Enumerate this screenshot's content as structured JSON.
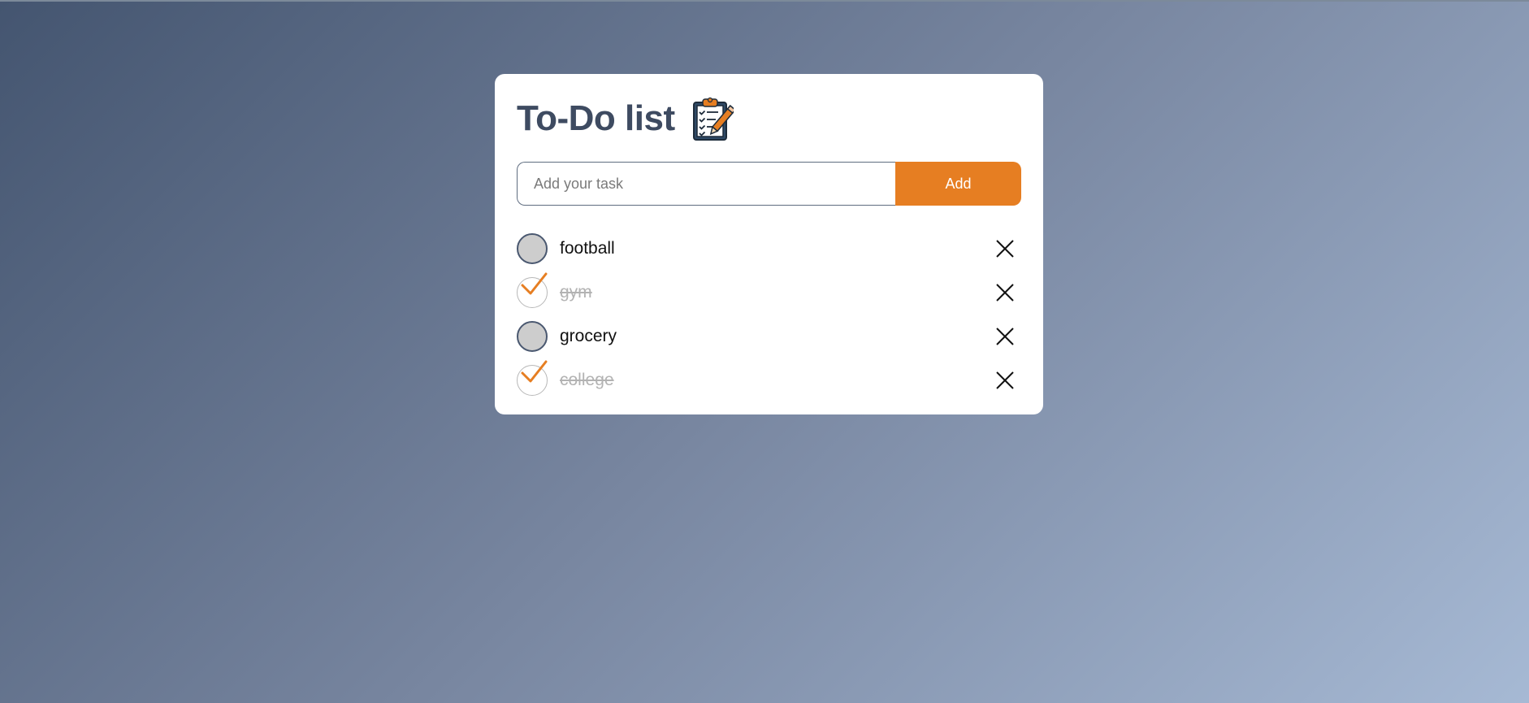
{
  "app": {
    "title": "To-Do list",
    "title_icon": "clipboard-checklist-pencil-icon"
  },
  "form": {
    "placeholder": "Add your task",
    "value": "",
    "add_label": "Add"
  },
  "tasks": [
    {
      "text": "football",
      "completed": false
    },
    {
      "text": "gym",
      "completed": true
    },
    {
      "text": "grocery",
      "completed": false
    },
    {
      "text": "college",
      "completed": true
    }
  ],
  "colors": {
    "accent": "#e67e22",
    "title": "#3e4b61",
    "unchecked_fill": "#cdcdcd",
    "completed_text": "#b3b3b3"
  },
  "icons": {
    "delete": "close-icon",
    "check": "checkmark-icon"
  }
}
